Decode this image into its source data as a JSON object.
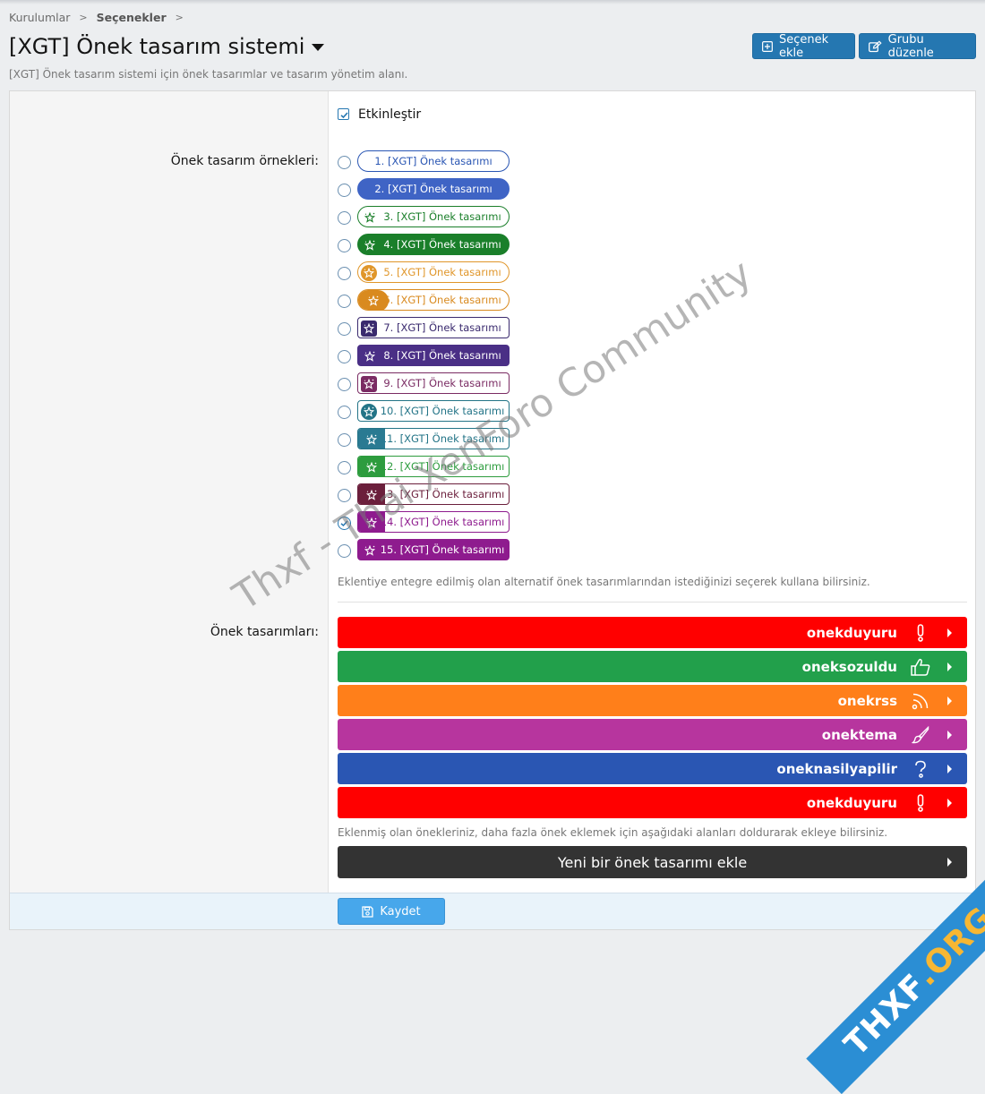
{
  "breadcrumb": {
    "item1": "Kurulumlar",
    "item2": "Seçenekler",
    "sep": ">"
  },
  "page": {
    "title": "[XGT] Önek tasarım sistemi",
    "description": "[XGT] Önek tasarım sistemi için önek tasarımlar ve tasarım yönetim alanı."
  },
  "header_buttons": {
    "add_label": "Seçenek ekle",
    "edit_label": "Grubu düzenle"
  },
  "enable": {
    "label": "Etkinleştir",
    "checked": true
  },
  "examples": {
    "label": "Önek tasarım örnekleri:",
    "hint": "Eklentiye entegre edilmiş olan alternatif önek tasarımlarından istediğinizi seçerek kullana bilirsiniz.",
    "selected_index": 14,
    "items": [
      {
        "label": "1. [XGT] Önek tasarımı"
      },
      {
        "label": "2. [XGT] Önek tasarımı"
      },
      {
        "label": "3. [XGT] Önek tasarımı"
      },
      {
        "label": "4. [XGT] Önek tasarımı"
      },
      {
        "label": "5. [XGT] Önek tasarımı"
      },
      {
        "label": "6. [XGT] Önek tasarımı"
      },
      {
        "label": "7. [XGT] Önek tasarımı"
      },
      {
        "label": "8. [XGT] Önek tasarımı"
      },
      {
        "label": "9. [XGT] Önek tasarımı"
      },
      {
        "label": "10. [XGT] Önek tasarımı"
      },
      {
        "label": "11. [XGT] Önek tasarımı"
      },
      {
        "label": "12. [XGT] Önek tasarımı"
      },
      {
        "label": "13. [XGT] Önek tasarımı"
      },
      {
        "label": "14. [XGT] Önek tasarımı"
      },
      {
        "label": "15. [XGT] Önek tasarımı"
      }
    ]
  },
  "prefixes": {
    "label": "Önek tasarımları:",
    "hint": "Eklenmiş olan önekleriniz, daha fazla önek eklemek için aşağıdaki alanları doldurarak ekleye bilirsiniz.",
    "items": [
      {
        "name": "onekduyuru",
        "icon": "exclamation-icon",
        "color": "#ff0000"
      },
      {
        "name": "oneksozuldu",
        "icon": "thumbs-up-icon",
        "color": "#22a04b"
      },
      {
        "name": "onekrss",
        "icon": "rss-icon",
        "color": "#ff7f1a"
      },
      {
        "name": "onektema",
        "icon": "brush-icon",
        "color": "#b7359e"
      },
      {
        "name": "oneknasilyapilir",
        "icon": "question-icon",
        "color": "#2a56b3"
      },
      {
        "name": "onekduyuru",
        "icon": "exclamation-icon",
        "color": "#ff0000"
      }
    ],
    "add_label": "Yeni bir önek tasarımı ekle"
  },
  "footer": {
    "save_label": "Kaydet"
  },
  "watermark": {
    "text": "Thxf - Thai XenForo Community",
    "corner_main": "THXF",
    "corner_accent": ".ORG"
  }
}
